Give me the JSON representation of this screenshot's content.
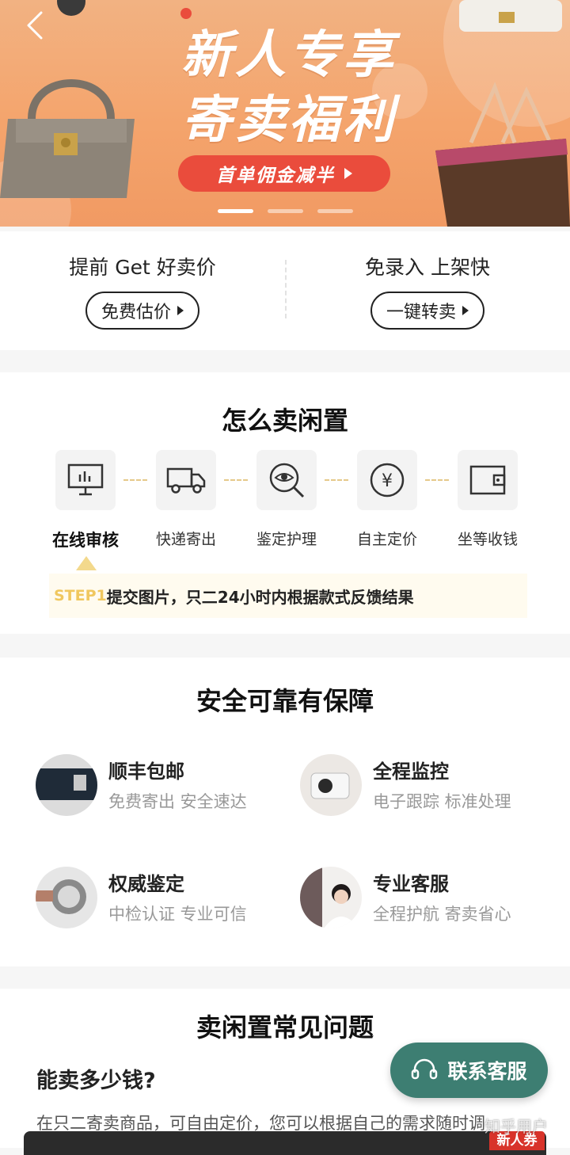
{
  "banner": {
    "title_line1": "新人专享",
    "title_line2": "寄卖福利",
    "cta": "首单佣金减半"
  },
  "quick": [
    {
      "title": "提前 Get 好卖价",
      "button": "免费估价"
    },
    {
      "title": "免录入 上架快",
      "button": "一键转卖"
    }
  ],
  "how": {
    "title": "怎么卖闲置",
    "steps": [
      {
        "label": "在线审核",
        "icon": "monitor-icon"
      },
      {
        "label": "快递寄出",
        "icon": "truck-icon"
      },
      {
        "label": "鉴定护理",
        "icon": "eye-magnifier-icon"
      },
      {
        "label": "自主定价",
        "icon": "yen-icon"
      },
      {
        "label": "坐等收钱",
        "icon": "wallet-icon"
      }
    ],
    "step_tag": "STEP1",
    "step_desc": "提交图片，只二24小时内根据款式反馈结果"
  },
  "safe": {
    "title": "安全可靠有保障",
    "features": [
      {
        "title": "顺丰包邮",
        "desc": "免费寄出 安全速达"
      },
      {
        "title": "全程监控",
        "desc": "电子跟踪 标准处理"
      },
      {
        "title": "权威鉴定",
        "desc": "中检认证 专业可信"
      },
      {
        "title": "专业客服",
        "desc": "全程护航 寄卖省心"
      }
    ]
  },
  "faq": {
    "title": "卖闲置常见问题",
    "question": "能卖多少钱?",
    "answer": "在只二寄卖商品，可自由定价，您可以根据自己的需求随时调"
  },
  "contact": {
    "label": "联系客服"
  },
  "coupon": {
    "label": "新人券"
  },
  "watermark": "知乎用户",
  "colors": {
    "accent_green": "#3d7e72",
    "banner_orange": "#f4a46c",
    "cta_red": "#ea4c3c",
    "step_gold": "#f0c75e"
  }
}
